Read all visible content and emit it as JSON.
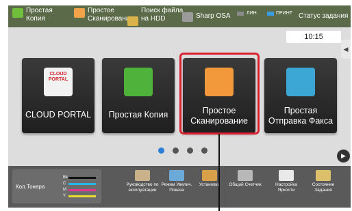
{
  "topbar": {
    "items": [
      {
        "line1": "Простая",
        "line2": "Копия",
        "icon": "copy-icon",
        "color": "#6fbf3d"
      },
      {
        "line1": "Простое",
        "line2": "Сканирование",
        "icon": "scan-icon",
        "color": "#f3a34a"
      },
      {
        "line1": "Поиск файла",
        "line2": "на HDD",
        "icon": "folder-icon",
        "color": "#d9b24a"
      },
      {
        "line1": "Sharp OSA",
        "line2": "",
        "icon": "osa-icon",
        "color": "#9b9b9b"
      }
    ],
    "status_line": "ЛИН.",
    "status_print": "ПРИНТ",
    "job_status": "Статус задания"
  },
  "clock": "10:15",
  "side_tab_glyph": "◀",
  "tiles": [
    {
      "label": "CLOUD PORTAL",
      "icon": "cloud-portal-icon",
      "icon_text": "CLOUD PORTAL"
    },
    {
      "label": "Простая Копия",
      "icon": "copy-icon",
      "color": "#4fb23b"
    },
    {
      "label_line1": "Простое",
      "label_line2": "Сканирование",
      "icon": "scan-icon",
      "color": "#f29a3b"
    },
    {
      "label_line1": "Простая",
      "label_line2": "Отправка Факса",
      "icon": "fax-icon",
      "color": "#3ca7d4"
    }
  ],
  "pager": {
    "active_page": 1,
    "pages": 4
  },
  "next_glyph": "▶",
  "toner": {
    "label": "Кол.Тонера",
    "rows": [
      {
        "code": "Bk",
        "color": "#111111"
      },
      {
        "code": "C",
        "color": "#2ab7e6"
      },
      {
        "code": "M",
        "color": "#e0368f"
      },
      {
        "code": "Y",
        "color": "#e9dd2a"
      }
    ]
  },
  "functions": [
    {
      "label": "Руководство по эксплуатации",
      "icon": "manual-icon",
      "color": "#c9b28a"
    },
    {
      "label": "Режим Увелич. Показа",
      "icon": "zoom-text-icon",
      "color": "#6aa9d8"
    },
    {
      "label": "Установки",
      "icon": "wrench-icon",
      "color": "#d9a04a"
    },
    {
      "label": "Общий Счетчик",
      "icon": "counter-icon",
      "color": "#b8b8b8"
    },
    {
      "label": "Настройка Яркости",
      "icon": "brightness-icon",
      "color": "#e9e9e9"
    },
    {
      "label": "Состояние Задания",
      "icon": "job-status-icon",
      "color": "#dcbf6a"
    }
  ]
}
